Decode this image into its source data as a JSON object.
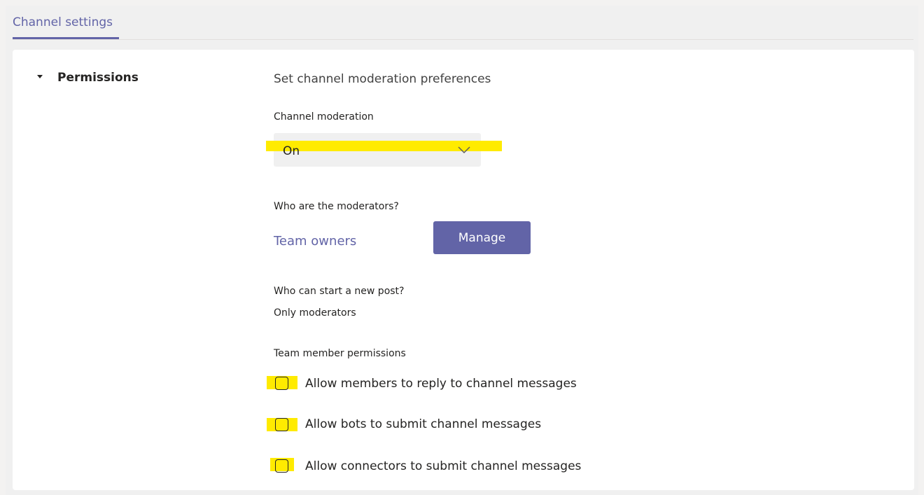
{
  "tabs": {
    "channel_settings": "Channel settings"
  },
  "section": {
    "title": "Permissions"
  },
  "content": {
    "heading": "Set channel moderation preferences",
    "moderation_label": "Channel moderation",
    "moderation_value": "On",
    "moderators_label": "Who are the moderators?",
    "moderators_link": "Team owners",
    "manage_label": "Manage",
    "post_label": "Who can start a new post?",
    "post_value": "Only moderators",
    "member_perms_label": "Team member permissions",
    "checkboxes": [
      {
        "label": "Allow members to reply to channel messages",
        "checked": false
      },
      {
        "label": "Allow bots to submit channel messages",
        "checked": false
      },
      {
        "label": "Allow connectors to submit channel messages",
        "checked": false
      }
    ]
  },
  "colors": {
    "accent": "#6264a7",
    "highlight": "#ffeb00",
    "background": "#f0f0f0",
    "panel": "#ffffff"
  }
}
